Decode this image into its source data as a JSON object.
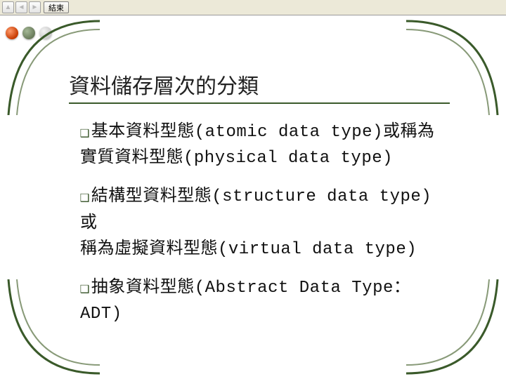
{
  "viewer": {
    "end_label": "結束",
    "nav_prev_glyph": "◄",
    "nav_next_glyph": "►",
    "nav_up_glyph": "▲"
  },
  "slide": {
    "title": "資料儲存層次的分類",
    "bullet_glyph": "❑",
    "items": [
      {
        "lead": "基本資料型態(atomic data type)或稱為",
        "cont": "實質資料型態(physical data type)"
      },
      {
        "lead": "結構型資料型態(structure data type)或",
        "cont": "稱為虛擬資料型態(virtual data type)"
      },
      {
        "lead": "抽象資料型態(Abstract Data Type：ADT)",
        "cont": ""
      }
    ]
  },
  "theme": {
    "accent": "#3a5a2a",
    "dot_colors": [
      "#c63a00",
      "#687a5a",
      "#c9c9c9"
    ]
  }
}
